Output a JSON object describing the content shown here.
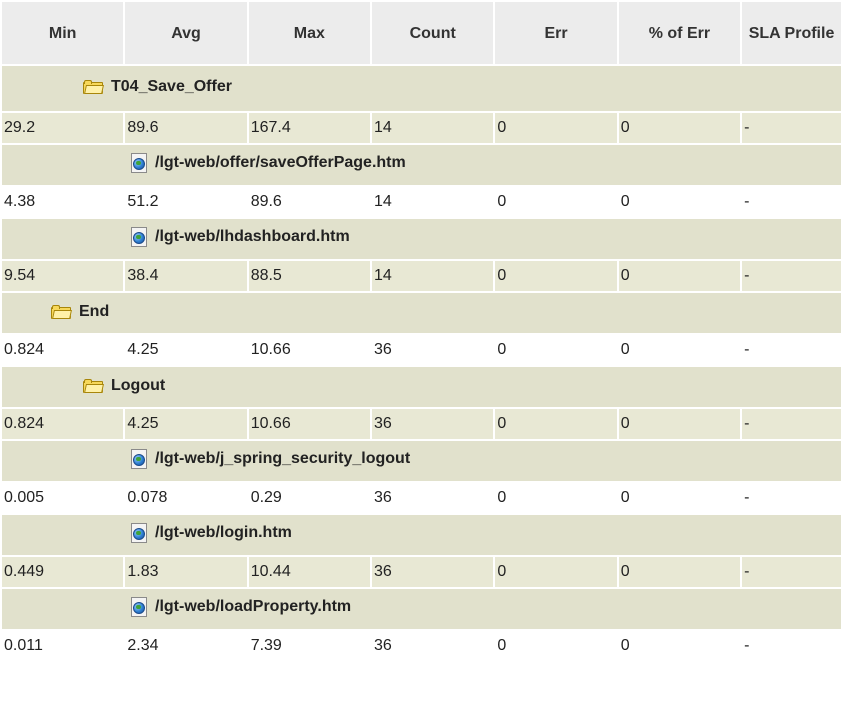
{
  "columns": [
    "Min",
    "Avg",
    "Max",
    "Count",
    "Err",
    "% of Err",
    "SLA Profile"
  ],
  "colors": {
    "header_bg": "#ececec",
    "group_bg": "#e1e1cc",
    "row_bg": "#e8e8d4",
    "white": "#ffffff"
  },
  "groups": [
    {
      "label": "T04_Save_Offer",
      "icon": "folder-icon",
      "row": {
        "min": "29.2",
        "avg": "89.6",
        "max": "167.4",
        "count": "14",
        "err": "0",
        "pct_err": "0",
        "sla": "-"
      }
    },
    {
      "label": "/lgt-web/offer/saveOfferPage.htm",
      "icon": "page-icon",
      "row": {
        "min": "4.38",
        "avg": "51.2",
        "max": "89.6",
        "count": "14",
        "err": "0",
        "pct_err": "0",
        "sla": "-"
      }
    },
    {
      "label": "/lgt-web/lhdashboard.htm",
      "icon": "page-icon",
      "row": {
        "min": "9.54",
        "avg": "38.4",
        "max": "88.5",
        "count": "14",
        "err": "0",
        "pct_err": "0",
        "sla": "-"
      }
    },
    {
      "label": "End",
      "icon": "folder-icon",
      "row": {
        "min": "0.824",
        "avg": "4.25",
        "max": "10.66",
        "count": "36",
        "err": "0",
        "pct_err": "0",
        "sla": "-"
      }
    },
    {
      "label": "Logout",
      "icon": "folder-icon",
      "row": {
        "min": "0.824",
        "avg": "4.25",
        "max": "10.66",
        "count": "36",
        "err": "0",
        "pct_err": "0",
        "sla": "-"
      }
    },
    {
      "label": "/lgt-web/j_spring_security_logout",
      "icon": "page-icon",
      "row": {
        "min": "0.005",
        "avg": "0.078",
        "max": "0.29",
        "count": "36",
        "err": "0",
        "pct_err": "0",
        "sla": "-"
      }
    },
    {
      "label": "/lgt-web/login.htm",
      "icon": "page-icon",
      "row": {
        "min": "0.449",
        "avg": "1.83",
        "max": "10.44",
        "count": "36",
        "err": "0",
        "pct_err": "0",
        "sla": "-"
      }
    },
    {
      "label": "/lgt-web/loadProperty.htm",
      "icon": "page-icon",
      "row": {
        "min": "0.011",
        "avg": "2.34",
        "max": "7.39",
        "count": "36",
        "err": "0",
        "pct_err": "0",
        "sla": "-"
      }
    }
  ]
}
